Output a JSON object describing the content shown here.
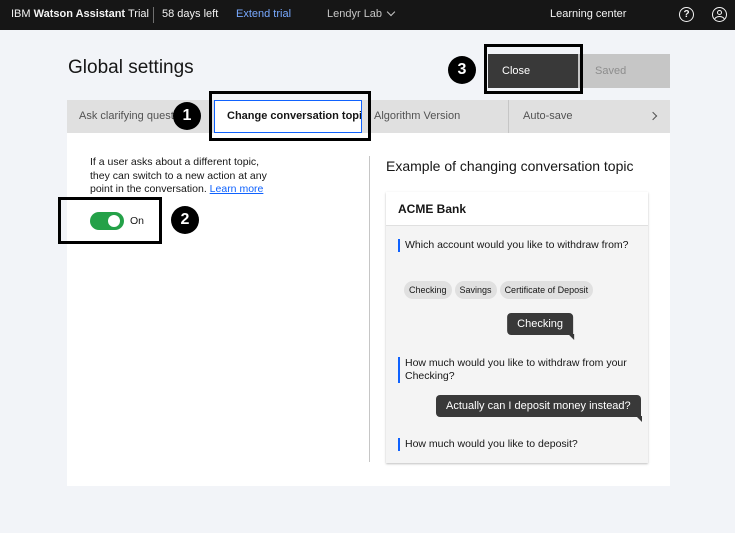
{
  "topbar": {
    "brand_prefix": "IBM",
    "brand_name": "Watson Assistant",
    "plan": "Trial",
    "days_left": "58 days left",
    "extend_link": "Extend trial",
    "workspace": "Lendyr Lab",
    "learning_center": "Learning center",
    "help_icon": "?",
    "icons": [
      "chevron-down-icon",
      "help-icon",
      "user-avatar-icon"
    ]
  },
  "header": {
    "title": "Global settings",
    "close_label": "Close",
    "saved_label": "Saved"
  },
  "tabs": [
    {
      "label": "Ask clarifying quest"
    },
    {
      "label": "Change conversation topic",
      "selected": true
    },
    {
      "label": "Algorithm Version"
    },
    {
      "label": "Auto-save"
    }
  ],
  "setting": {
    "description": "If a user asks about a different topic, they can switch to a new action at any point in the conversation.",
    "learn_more": "Learn more",
    "toggle_label": "On",
    "toggle_on": true,
    "toggle_color": "#24a148"
  },
  "example": {
    "title": "Example of changing conversation topic",
    "bank_name": "ACME Bank",
    "bot_1": "Which account would you like to withdraw from?",
    "chips": [
      "Checking",
      "Savings",
      "Certificate of Deposit"
    ],
    "user_1": "Checking",
    "bot_2": "How much would you like to withdraw from your Checking?",
    "user_2": "Actually can I deposit money instead?",
    "bot_3": "How much would you like to deposit?"
  },
  "annotations": [
    "1",
    "2",
    "3"
  ],
  "colors": {
    "accent": "#0f62fe",
    "topbar_bg": "#161616",
    "close_button": "#393939",
    "toggle_on": "#24a148"
  }
}
